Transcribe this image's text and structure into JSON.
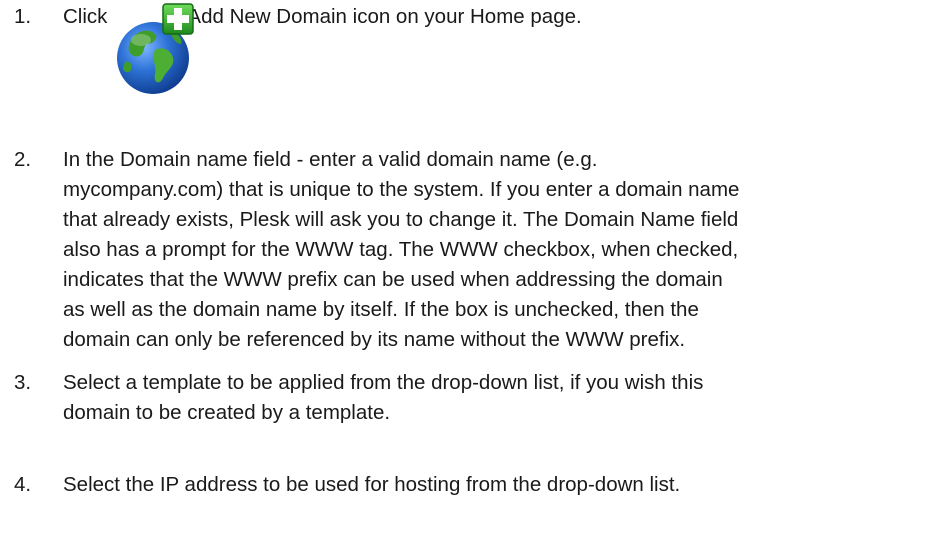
{
  "steps": [
    {
      "number": "1.",
      "before_icon": "Click",
      "icon": "add-new-domain-icon",
      "after_icon": "Add New Domain icon on your Home page."
    },
    {
      "number": "2.",
      "lines": [
        "In the Domain name field - enter a valid domain name (e.g.",
        "mycompany.com) that is unique to the system. If you enter a domain name",
        "that already exists, Plesk will ask you to change it. The Domain Name field",
        "also has a prompt for the WWW tag. The WWW checkbox, when checked,",
        "indicates that the WWW prefix can be used when addressing the domain",
        "as well as the domain name by itself. If the box is unchecked, then the",
        "domain can only be referenced by its name without the WWW prefix."
      ]
    },
    {
      "number": "3.",
      "lines": [
        "Select a template to be applied from the drop-down list, if you wish this",
        "domain to be created by a template."
      ]
    },
    {
      "number": "4.",
      "lines": [
        "Select the IP address to be used for hosting from the drop-down list."
      ]
    }
  ],
  "colors": {
    "text": "#1a1a1a",
    "globe_ocean": "#1f63c9",
    "globe_land": "#3f9e2a",
    "plus_badge": "#2ea82e"
  }
}
